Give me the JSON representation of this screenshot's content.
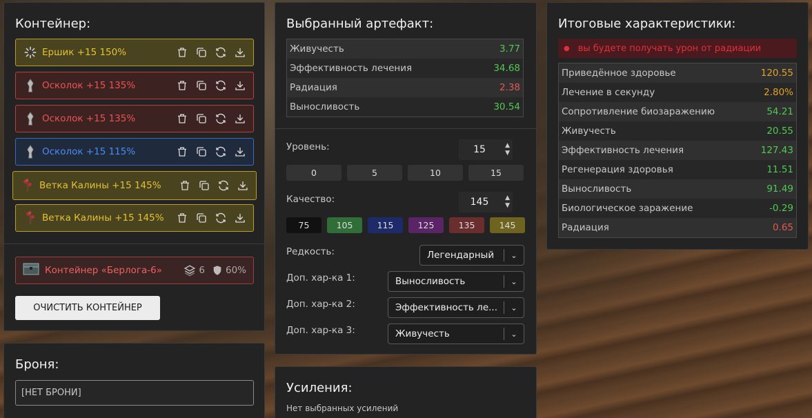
{
  "container_panel": {
    "title": "Контейнер:",
    "artifacts": [
      {
        "name": "Ершик +15 150%",
        "color": "yellow",
        "icon": "spiky-ball-icon",
        "selected": false
      },
      {
        "name": "Осколок +15 135%",
        "color": "red",
        "icon": "shard-icon",
        "selected": false
      },
      {
        "name": "Осколок +15 135%",
        "color": "red",
        "icon": "shard-icon",
        "selected": false
      },
      {
        "name": "Осколок +15 115%",
        "color": "blue",
        "icon": "shard-icon",
        "selected": false
      },
      {
        "name": "Ветка Калины +15 145%",
        "color": "yellow",
        "icon": "branch-icon",
        "selected": true
      },
      {
        "name": "Ветка Калины +15 145%",
        "color": "yellow",
        "icon": "branch-icon",
        "selected": false
      }
    ],
    "container": {
      "name": "Контейнер «Берлога-6»",
      "slots": "6",
      "protection": "60%"
    },
    "clear_button": "ОЧИСТИТЬ КОНТЕЙНЕР"
  },
  "armor_panel": {
    "title": "Броня:",
    "value": "[НЕТ БРОНИ]"
  },
  "selected_panel": {
    "title": "Выбранный артефакт:",
    "stats": [
      {
        "label": "Живучесть",
        "value": "3.77",
        "tone": "green"
      },
      {
        "label": "Эффективность лечения",
        "value": "34.68",
        "tone": "green"
      },
      {
        "label": "Радиация",
        "value": "2.38",
        "tone": "redv"
      },
      {
        "label": "Выносливость",
        "value": "30.54",
        "tone": "green"
      }
    ],
    "level_label": "Уровень:",
    "level_value": "15",
    "level_presets": [
      "0",
      "5",
      "10",
      "15"
    ],
    "quality_label": "Качество:",
    "quality_value": "145",
    "quality_presets": [
      {
        "label": "75",
        "color": "#111111"
      },
      {
        "label": "105",
        "color": "#2f6e36"
      },
      {
        "label": "115",
        "color": "#1e2a6a"
      },
      {
        "label": "125",
        "color": "#5a2466"
      },
      {
        "label": "135",
        "color": "#6a2e2e"
      },
      {
        "label": "145",
        "color": "#6e6420"
      }
    ],
    "rarity_label": "Редкость:",
    "rarity_value": "Легендарный",
    "extra1_label": "Доп. хар-ка 1:",
    "extra1_value": "Выносливость",
    "extra2_label": "Доп. хар-ка 2:",
    "extra2_value": "Эффективность ле...",
    "extra3_label": "Доп. хар-ка 3:",
    "extra3_value": "Живучесть"
  },
  "boost_panel": {
    "title": "Усиления:",
    "empty_text": "Нет выбранных усилений"
  },
  "total_panel": {
    "title": "Итоговые характеристики:",
    "warning": "вы будете получать урон от радиации",
    "stats": [
      {
        "label": "Приведённое здоровье",
        "value": "120.55",
        "tone": "orange"
      },
      {
        "label": "Лечение в секунду",
        "value": "2.80%",
        "tone": "orange"
      },
      {
        "label": "Сопротивление биозаражению",
        "value": "54.21",
        "tone": "green"
      },
      {
        "label": "Живучесть",
        "value": "20.55",
        "tone": "green"
      },
      {
        "label": "Эффективность лечения",
        "value": "127.43",
        "tone": "green"
      },
      {
        "label": "Регенерация здоровья",
        "value": "11.51",
        "tone": "green"
      },
      {
        "label": "Выносливость",
        "value": "91.49",
        "tone": "green"
      },
      {
        "label": "Биологическое заражение",
        "value": "-0.29",
        "tone": "green"
      },
      {
        "label": "Радиация",
        "value": "0.65",
        "tone": "redv"
      }
    ]
  }
}
